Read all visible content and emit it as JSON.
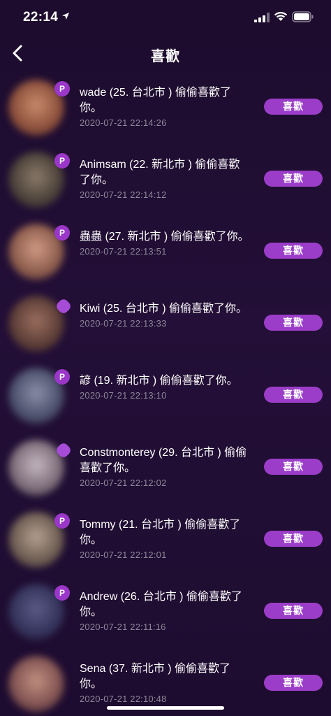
{
  "status": {
    "time": "22:14"
  },
  "nav": {
    "title": "喜歡"
  },
  "items": [
    {
      "message": "wade (25. 台北市 ) 偷偷喜歡了你。",
      "time": "2020-07-21 22:14:26",
      "button": "喜歡",
      "badge": "P",
      "avatar_color": "#a0624a"
    },
    {
      "message": "Animsam (22. 新北市 ) 偷偷喜歡了你。",
      "time": "2020-07-21 22:14:12",
      "button": "喜歡",
      "badge": "P",
      "avatar_color": "#5a5048"
    },
    {
      "message": "蟲蟲 (27. 新北市 ) 偷偷喜歡了你。",
      "time": "2020-07-21 22:13:51",
      "button": "喜歡",
      "badge": "P",
      "avatar_color": "#9a6a5a"
    },
    {
      "message": "Kiwi (25. 台北市 ) 偷偷喜歡了你。",
      "time": "2020-07-21 22:13:33",
      "button": "喜歡",
      "badge": "",
      "avatar_color": "#6e4e44"
    },
    {
      "message": "諺 (19. 新北市 ) 偷偷喜歡了你。",
      "time": "2020-07-21 22:13:10",
      "button": "喜歡",
      "badge": "P",
      "avatar_color": "#5a5e78"
    },
    {
      "message": "Constmonterey (29. 台北市 ) 偷偷喜歡了你。",
      "time": "2020-07-21 22:12:02",
      "button": "喜歡",
      "badge": "",
      "avatar_color": "#8a7a86"
    },
    {
      "message": "Tommy (21. 台北市 ) 偷偷喜歡了你。",
      "time": "2020-07-21 22:12:01",
      "button": "喜歡",
      "badge": "P",
      "avatar_color": "#7a6a60"
    },
    {
      "message": "Andrew (26. 台北市 ) 偷偷喜歡了你。",
      "time": "2020-07-21 22:11:16",
      "button": "喜歡",
      "badge": "P",
      "avatar_color": "#3a3656"
    },
    {
      "message": "Sena (37. 新北市 ) 偷偷喜歡了你。",
      "time": "2020-07-21 22:10:48",
      "button": "喜歡",
      "badge": "",
      "avatar_color": "#8e6060"
    }
  ],
  "colors": {
    "background": "#1d0c2e",
    "accent": "#9b3dc8",
    "timestamp": "#8e8698"
  }
}
